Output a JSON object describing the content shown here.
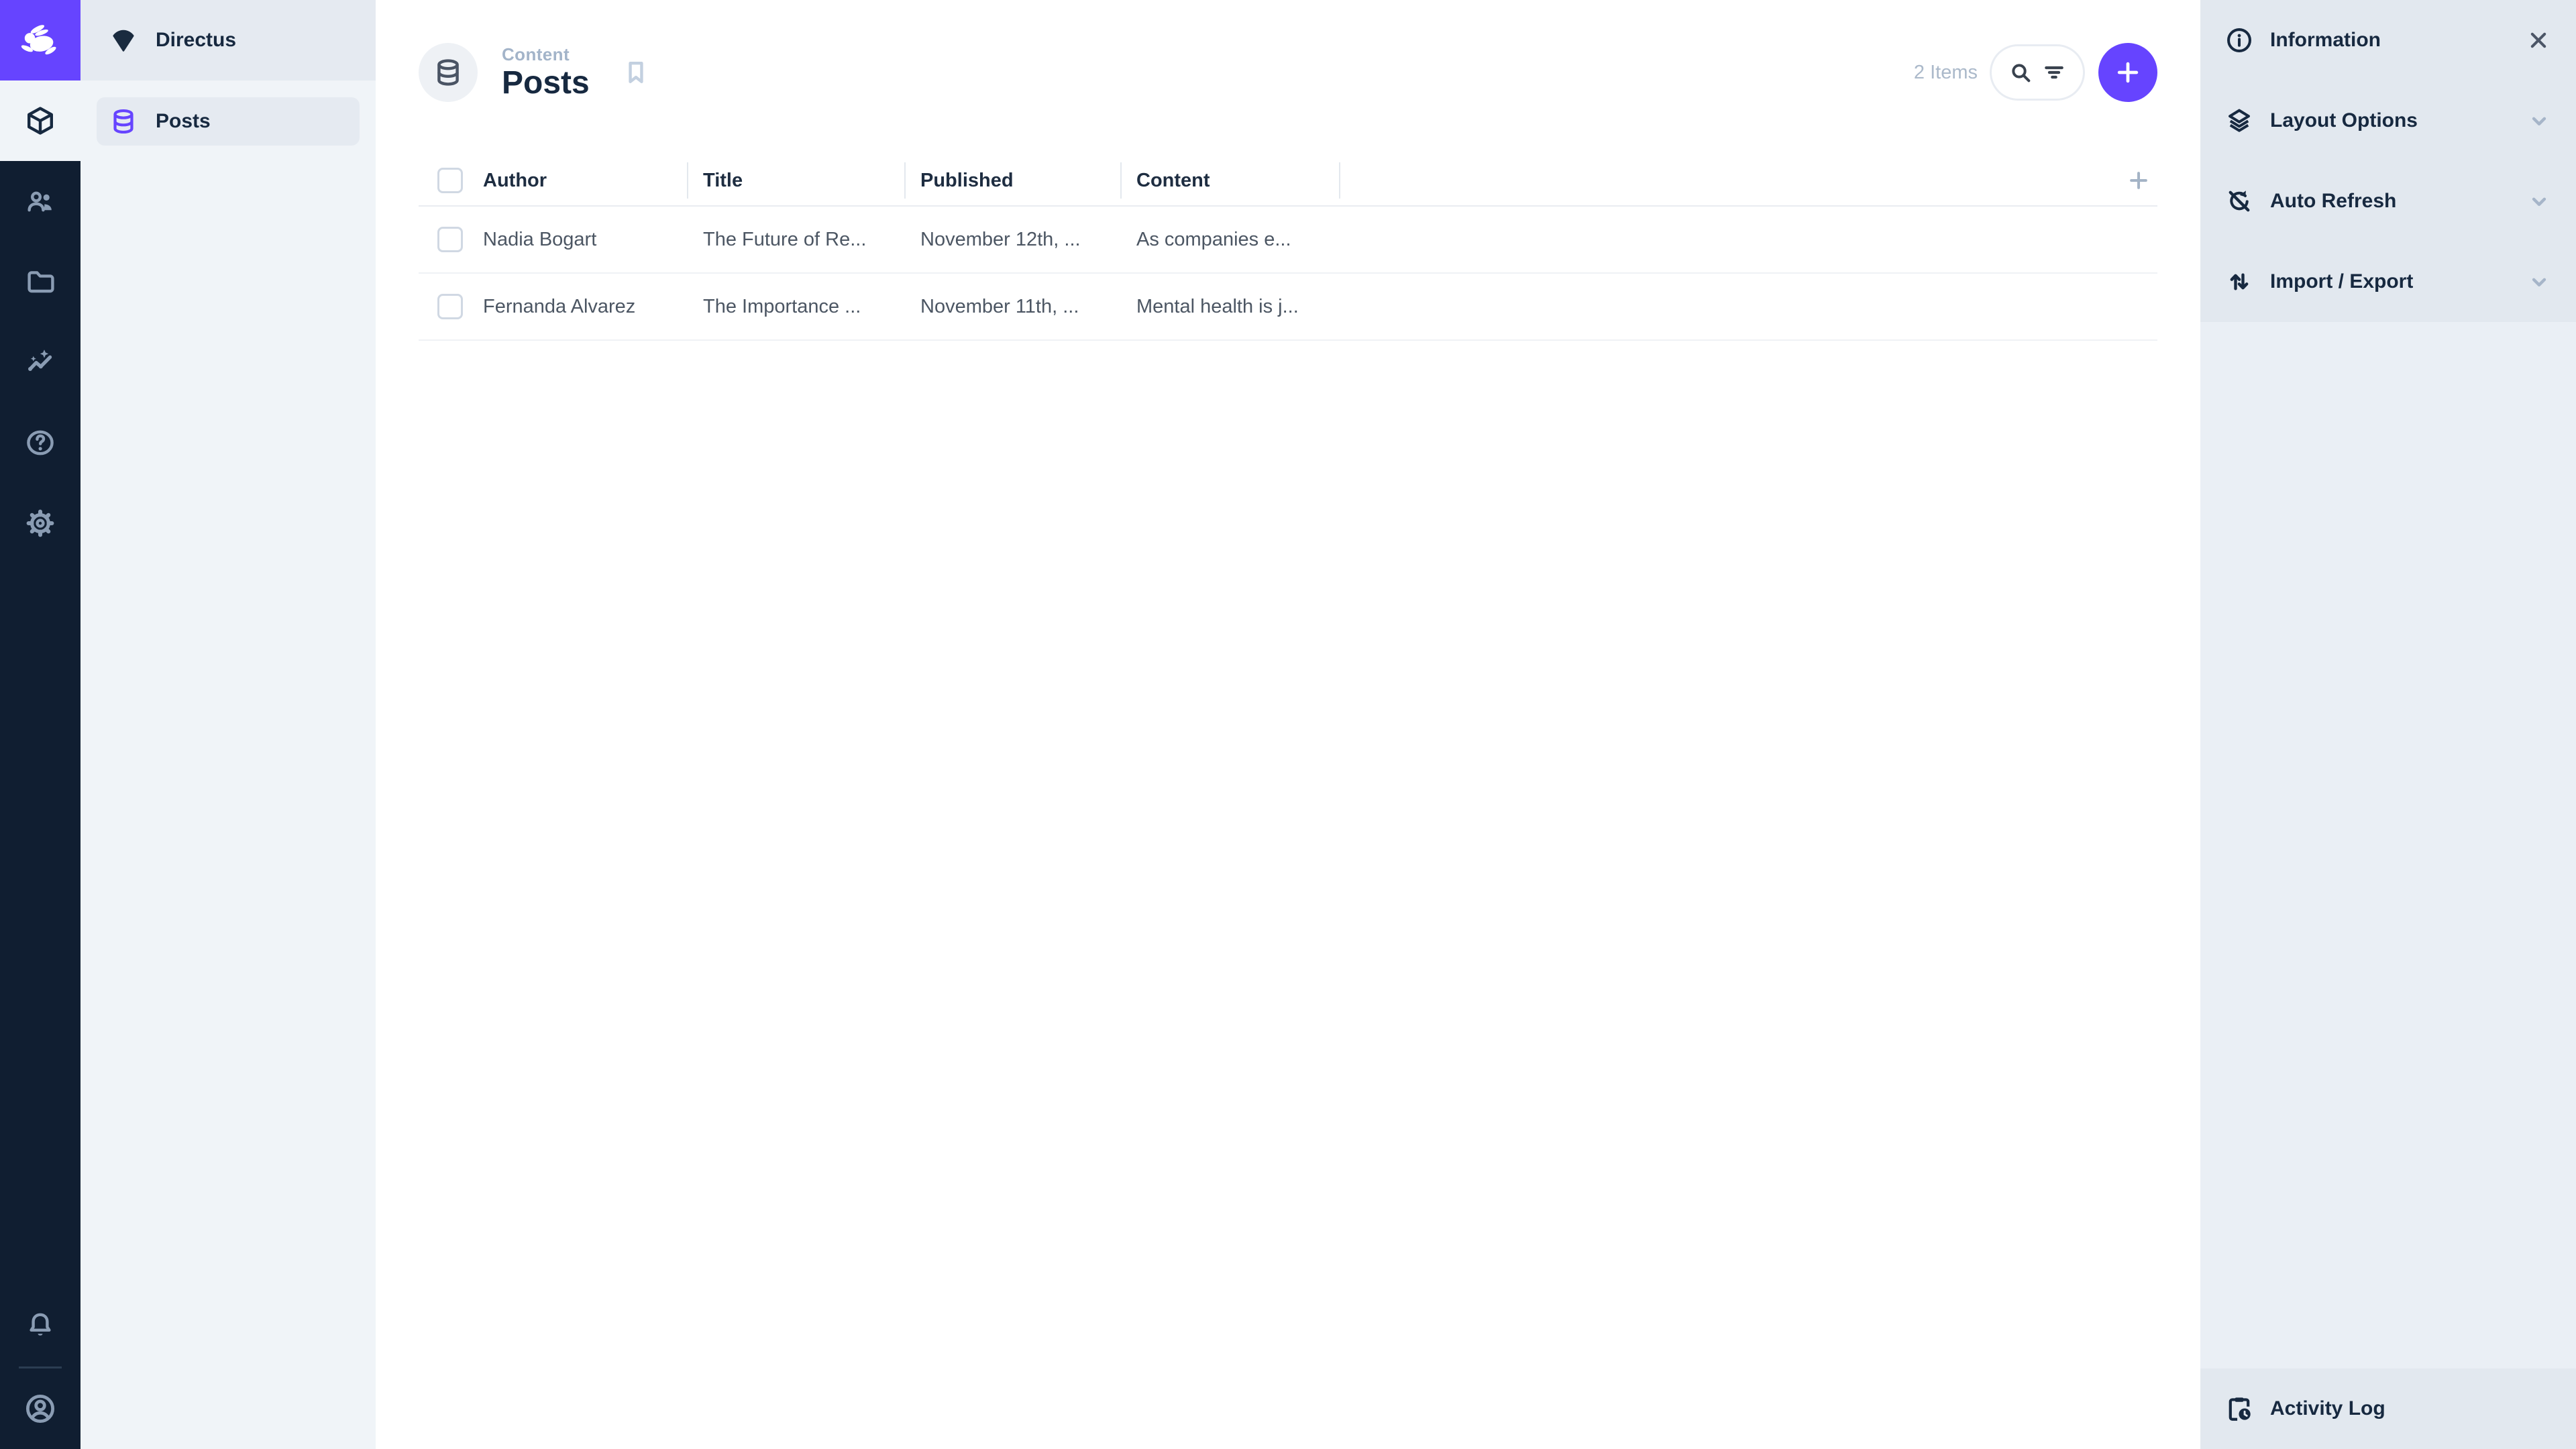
{
  "app": {
    "project_name": "Directus"
  },
  "module_bar": {
    "logo_icon": "directus-rabbit-logo",
    "modules": [
      {
        "icon": "box-icon",
        "active": true
      },
      {
        "icon": "users-icon",
        "active": false
      },
      {
        "icon": "folder-icon",
        "active": false
      },
      {
        "icon": "insights-icon",
        "active": false
      },
      {
        "icon": "help-icon",
        "active": false
      },
      {
        "icon": "settings-icon",
        "active": false
      }
    ],
    "bottom_icons": [
      "bell-icon",
      "user-circle-icon"
    ]
  },
  "nav": {
    "items": [
      {
        "label": "Posts",
        "icon": "database-icon",
        "active": true
      }
    ]
  },
  "header": {
    "breadcrumb": "Content",
    "title": "Posts",
    "items_count": "2 Items",
    "icons": [
      "database-icon",
      "bookmark-icon",
      "search-icon",
      "filter-icon",
      "plus-icon"
    ]
  },
  "table": {
    "columns": [
      "Author",
      "Title",
      "Published",
      "Content"
    ],
    "rows": [
      {
        "author": "Nadia Bogart",
        "title": "The Future of Re...",
        "published": "November 12th, ...",
        "content": "As companies e..."
      },
      {
        "author": "Fernanda Alvarez",
        "title": "The Importance ...",
        "published": "November 11th, ...",
        "content": "Mental health is j..."
      }
    ]
  },
  "sidebar": {
    "sections": [
      {
        "label": "Information",
        "icon": "info-icon",
        "trailing_icon": "close-icon"
      },
      {
        "label": "Layout Options",
        "icon": "layers-icon",
        "trailing_icon": "chevron-down-icon"
      },
      {
        "label": "Auto Refresh",
        "icon": "sync-disabled-icon",
        "trailing_icon": "chevron-down-icon"
      },
      {
        "label": "Import / Export",
        "icon": "swap-vert-icon",
        "trailing_icon": "chevron-down-icon"
      }
    ],
    "activity_log": {
      "label": "Activity Log",
      "icon": "activity-log-icon"
    }
  },
  "colors": {
    "accent": "#6644FF",
    "module_bar_bg": "#101E31",
    "module_icon": "#8A9CB3",
    "nav_bg": "#F0F4F8",
    "nav_active_bg": "#E5EAF1",
    "sidebar_section_bg": "#E2E8EF",
    "sidebar_middle_bg": "#EAEFF5",
    "text_dark": "#172940",
    "text_table": "#4C5663",
    "text_muted": "#ABB9CA"
  }
}
